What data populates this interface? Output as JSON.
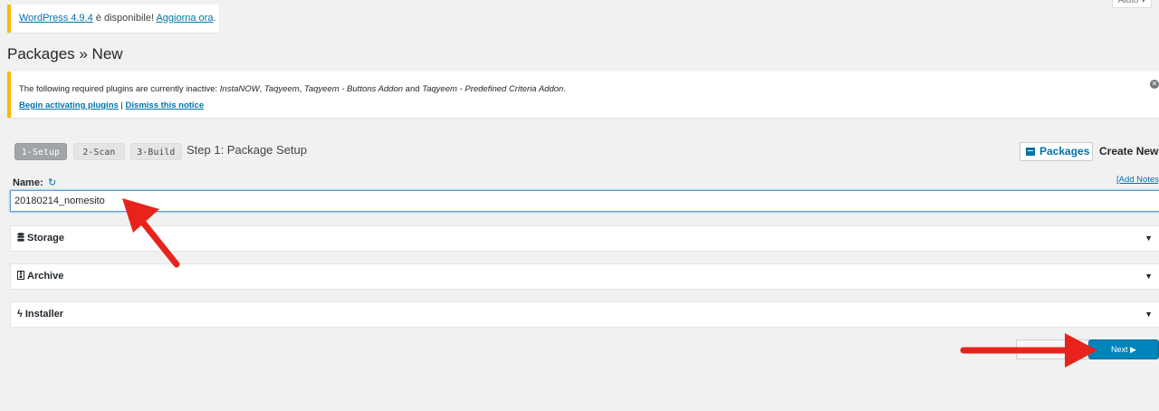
{
  "help_tab": {
    "label": "Aiuto ▾"
  },
  "update_notice": {
    "link": "WordPress 4.9.4",
    "middle": " è disponibile! ",
    "action": "Aggiorna ora",
    "end": "."
  },
  "page_title": "Packages » New",
  "plugins_notice": {
    "intro": "The following required plugins are currently inactive: ",
    "p1": "InstaNOW",
    "sep1": ", ",
    "p2": "Taqyeem",
    "sep2": ", ",
    "p3": "Taqyeem - Buttons Addon",
    "and": " and ",
    "p4": "Taqyeem - Predefined Criteria Addon",
    "end": ".",
    "activate": "Begin activating plugins",
    "divider": " | ",
    "dismiss": "Dismiss this notice"
  },
  "steps": {
    "s1": "1-Setup",
    "s2": "2-Scan",
    "s3": "3-Build",
    "title": "Step 1: Package Setup"
  },
  "header_actions": {
    "packages": "Packages",
    "create_new": "Create New"
  },
  "form": {
    "name_label": "Name:",
    "add_notes": "[Add Notes]",
    "name_value": "20180214_nomesito"
  },
  "panels": {
    "storage": "Storage",
    "archive": "Archive",
    "installer": "Installer"
  },
  "buttons": {
    "next": "Next ▶"
  },
  "colors": {
    "accent": "#0073aa",
    "primary_button": "#0085ba",
    "warning": "#ffb900",
    "annotation_arrow": "#e8231b"
  },
  "icons": [
    "refresh-icon",
    "package-icon",
    "database-icon",
    "file-archive-icon",
    "bolt-icon",
    "caret-down-icon",
    "dismiss-icon"
  ]
}
